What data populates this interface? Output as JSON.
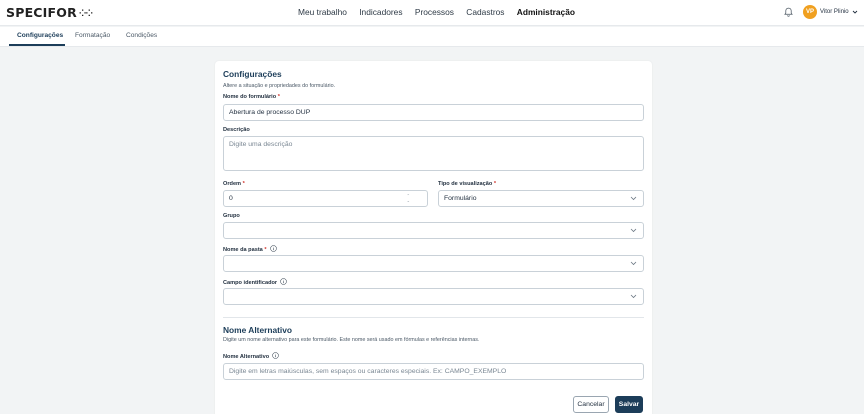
{
  "app": {
    "logo": "SPECIFOR",
    "logo_mark": "⁘⁘"
  },
  "nav": {
    "items": [
      "Meu trabalho",
      "Indicadores",
      "Processos",
      "Cadastros",
      "Administração"
    ],
    "active": "Administração"
  },
  "user": {
    "initials": "VP",
    "name": "Vitor Plinio"
  },
  "tabs": {
    "items": [
      "Configurações",
      "Formatação",
      "Condições"
    ],
    "active": "Configurações"
  },
  "config": {
    "title": "Configurações",
    "description": "Altere a situação e propriedades do formulário.",
    "nome_label": "Nome do formulário",
    "nome_value": "Abertura de processo DUP",
    "descricao_label": "Descrição",
    "descricao_placeholder": "Digite uma descrição",
    "ordem_label": "Ordem",
    "ordem_value": "0",
    "tipo_label": "Tipo de visualização",
    "tipo_value": "Formulário",
    "grupo_label": "Grupo",
    "pasta_label": "Nome da pasta",
    "campo_label": "Campo identificador"
  },
  "alt": {
    "title": "Nome Alternativo",
    "description": "Digite um nome alternativo para este formulário. Este nome será usado em fórmulas e referências internas.",
    "label": "Nome Alternativo",
    "placeholder": "Digite em letras maiúsculas, sem espaços ou caracteres especiais. Ex: CAMPO_EXEMPLO"
  },
  "actions": {
    "cancel": "Cancelar",
    "save": "Salvar"
  },
  "colors": {
    "primary": "#1c3d59",
    "required": "#d0342c",
    "avatar": "#f0a020"
  },
  "icons": [
    "bell-icon",
    "chevron-down-icon",
    "info-icon"
  ]
}
